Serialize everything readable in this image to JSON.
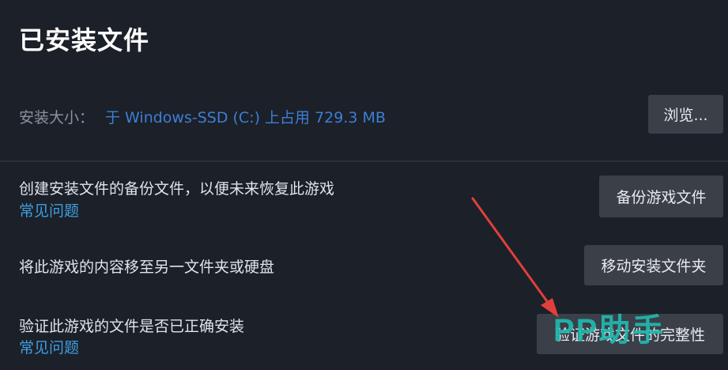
{
  "header": {
    "title": "已安装文件"
  },
  "install_size": {
    "label": "安装大小：",
    "value": "于 Windows-SSD (C:) 上占用 729.3 MB",
    "browse_label": "浏览..."
  },
  "backup": {
    "description": "创建安装文件的备份文件，以便未来恢复此游戏",
    "faq_label": "常见问题",
    "button_label": "备份游戏文件"
  },
  "move": {
    "description": "将此游戏的内容移至另一文件夹或硬盘",
    "button_label": "移动安装文件夹"
  },
  "verify": {
    "description": "验证此游戏的文件是否已正确安装",
    "faq_label": "常见问题",
    "button_label": "验证游戏文件的完整性"
  },
  "overlay": {
    "watermark": "PP助手",
    "arrow_color": "#e0403a",
    "watermark_color": "#1fb9ae"
  }
}
